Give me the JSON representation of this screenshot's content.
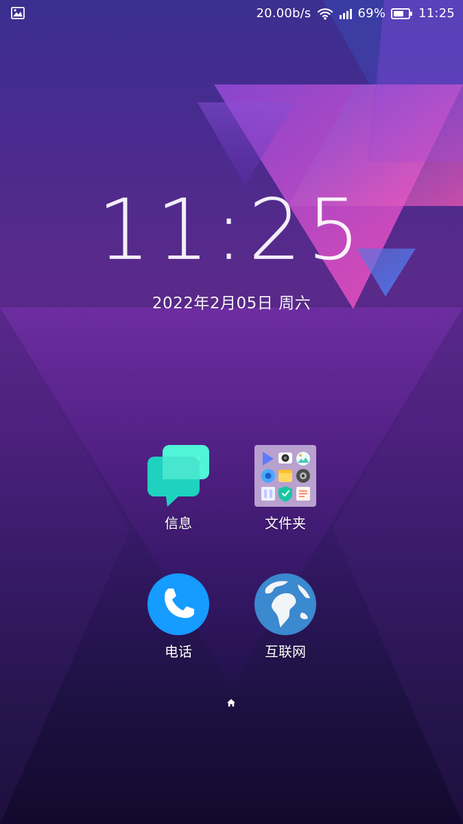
{
  "status_bar": {
    "speed": "20.00b/s",
    "battery_percent_text": "69%",
    "battery_level": 69,
    "time": "11:25",
    "left_icon": "image-icon",
    "right_icons": [
      "wifi-icon",
      "signal-icon",
      "battery-icon"
    ]
  },
  "lockscreen": {
    "clock": "11:25",
    "date": "2022年2月05日  周六"
  },
  "apps": [
    {
      "name": "message",
      "label": "信息",
      "icon": "message-icon"
    },
    {
      "name": "folder",
      "label": "文件夹",
      "icon": "folder-icon"
    },
    {
      "name": "phone",
      "label": "电话",
      "icon": "phone-icon"
    },
    {
      "name": "browser",
      "label": "互联网",
      "icon": "globe-icon"
    }
  ],
  "home_indicator": {
    "icon": "home-icon"
  },
  "colors": {
    "message_bubble_front": "#1fd2bf",
    "message_bubble_back": "#4ff5d6",
    "phone_bg": "#169bff",
    "globe_ocean": "#3b89cf",
    "globe_land": "#f2f5f7",
    "folder_bg": "#b8a1cf"
  }
}
